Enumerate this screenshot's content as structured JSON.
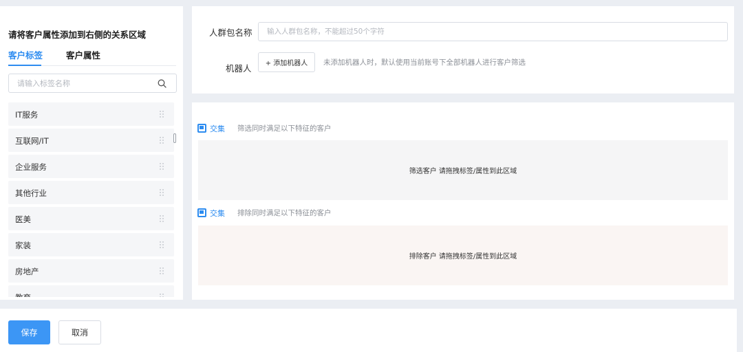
{
  "left_panel": {
    "title": "请将客户属性添加到右侧的关系区域",
    "tabs": [
      {
        "label": "客户标签",
        "active": true
      },
      {
        "label": "客户属性",
        "active": false
      }
    ],
    "search_placeholder": "请输入标签名称",
    "tags": [
      "IT服务",
      "互联网/IT",
      "企业服务",
      "其他行业",
      "医美",
      "家装",
      "房地产",
      "教育"
    ]
  },
  "form": {
    "name_label": "人群包名称",
    "name_placeholder": "输入人群包名称，不能超过50个字符",
    "name_value": "",
    "robot_label": "机器人",
    "add_robot_label": "+ 添加机器人",
    "robot_hint": "未添加机器人时，默认使用当前账号下全部机器人进行客户筛选"
  },
  "rules": {
    "include": {
      "op_label": "交集",
      "description": "筛选同时满足以下特征的客户",
      "dropzone_text": "筛选客户 请拖拽标签/属性到此区域"
    },
    "exclude": {
      "op_label": "交集",
      "description": "排除同时满足以下特征的客户",
      "dropzone_text": "排除客户 请拖拽标签/属性到此区域"
    }
  },
  "footer": {
    "save_label": "保存",
    "cancel_label": "取消"
  },
  "colors": {
    "accent": "#2d8cf0",
    "primary_button": "#3c96f5",
    "page_background": "#ebeef3",
    "include_zone": "#f5f5f6",
    "exclude_zone": "#faf5f3"
  },
  "icons": {
    "search": "search-icon",
    "drag_handle": "drag-handle-icon",
    "intersection": "intersection-icon"
  }
}
